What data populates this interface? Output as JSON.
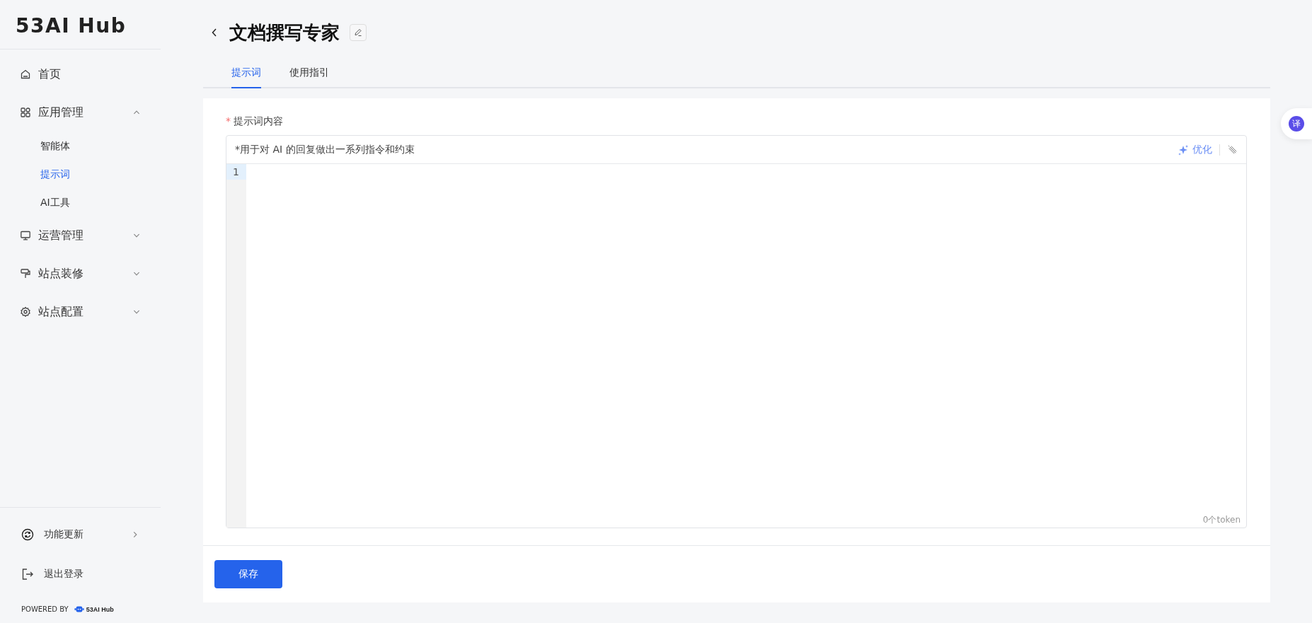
{
  "sidebar": {
    "logo": "53AI Hub",
    "items": [
      {
        "label": "首页"
      },
      {
        "label": "应用管理",
        "expanded": true,
        "children": [
          {
            "label": "智能体",
            "selected": false
          },
          {
            "label": "提示词",
            "selected": true
          },
          {
            "label": "AI工具",
            "selected": false
          }
        ]
      },
      {
        "label": "运营管理",
        "expanded": false
      },
      {
        "label": "站点装修",
        "expanded": false
      },
      {
        "label": "站点配置",
        "expanded": false
      }
    ],
    "footer_items": [
      {
        "label": "功能更新"
      },
      {
        "label": "退出登录"
      }
    ],
    "powered_by": "POWERED BY",
    "powered_logo": "53AI Hub"
  },
  "header": {
    "title": "文档撰写专家"
  },
  "tabs": [
    {
      "label": "提示词",
      "selected": true
    },
    {
      "label": "使用指引",
      "selected": false
    }
  ],
  "form": {
    "label": "提示词内容",
    "required_mark": "*",
    "hint": "*用于对 AI 的回复做出一系列指令和约束",
    "optimize": "优化",
    "line_numbers": [
      "1"
    ],
    "token_count": "0个token"
  },
  "save_button": "保存",
  "float_badge": "译"
}
